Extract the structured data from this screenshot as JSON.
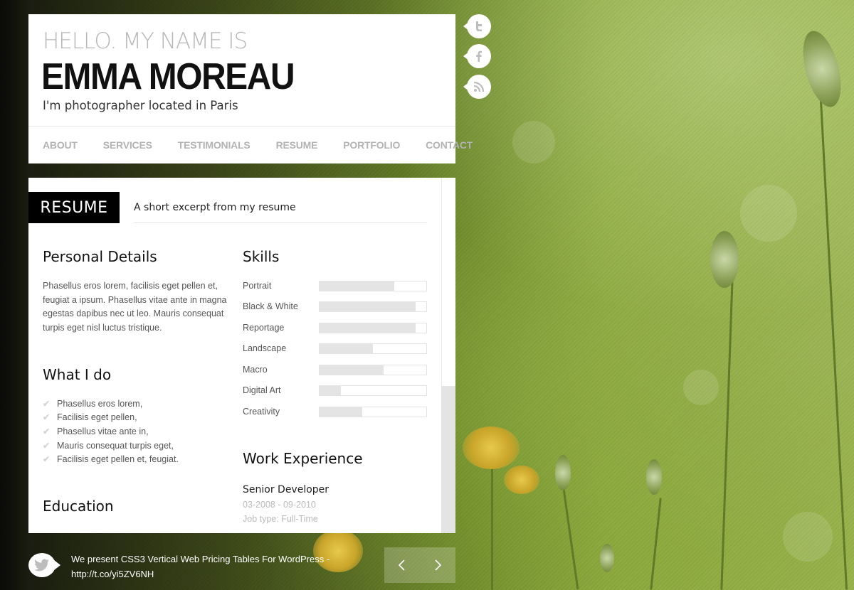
{
  "header": {
    "greeting": "HELLO. MY NAME IS",
    "name": "EMMA MOREAU",
    "tagline": "I'm photographer located in Paris"
  },
  "nav": {
    "items": [
      "ABOUT",
      "SERVICES",
      "TESTIMONIALS",
      "RESUME",
      "PORTFOLIO",
      "CONTACT"
    ],
    "active": "RESUME"
  },
  "social": [
    "twitter-icon",
    "facebook-icon",
    "rss-icon"
  ],
  "resume": {
    "section_label": "RESUME",
    "section_subtitle": "A short excerpt from my resume",
    "personal_details": {
      "heading": "Personal Details",
      "text": "Phasellus eros lorem, facilisis eget pellen et, feugiat a ipsum. Phasellus vitae ante in magna egestas dapibus nec ut leo. Mauris consequat turpis eget nisl luctus tristique."
    },
    "what_i_do": {
      "heading": "What I do",
      "items": [
        "Phasellus eros lorem,",
        "Facilisis eget pellen,",
        "Phasellus vitae ante in,",
        "Mauris consequat turpis eget,",
        "Facilisis eget pellen et, feugiat."
      ]
    },
    "education": {
      "heading": "Education"
    },
    "skills": {
      "heading": "Skills",
      "items": [
        {
          "label": "Portrait",
          "level": 0.7
        },
        {
          "label": "Black & White",
          "level": 0.9
        },
        {
          "label": "Reportage",
          "level": 0.9
        },
        {
          "label": "Landscape",
          "level": 0.5
        },
        {
          "label": "Macro",
          "level": 0.6
        },
        {
          "label": "Digital Art",
          "level": 0.2
        },
        {
          "label": "Creativity",
          "level": 0.4
        }
      ]
    },
    "work_experience": {
      "heading": "Work Experience",
      "job_title": "Senior Developer",
      "dates": "03-2008 - 09-2010",
      "job_type": "Job type: Full-Time"
    }
  },
  "footer": {
    "tweet_line1": "We present CSS3 Vertical Web Pricing Tables For WordPress -",
    "tweet_line2": "http://t.co/yi5ZV6NH",
    "prev": "‹",
    "next": "›"
  },
  "colors": {
    "panel": "#ffffff",
    "accent_dark": "#000000",
    "nav_text": "#b3b3b3",
    "skill_fill": "#e4e4e4"
  }
}
